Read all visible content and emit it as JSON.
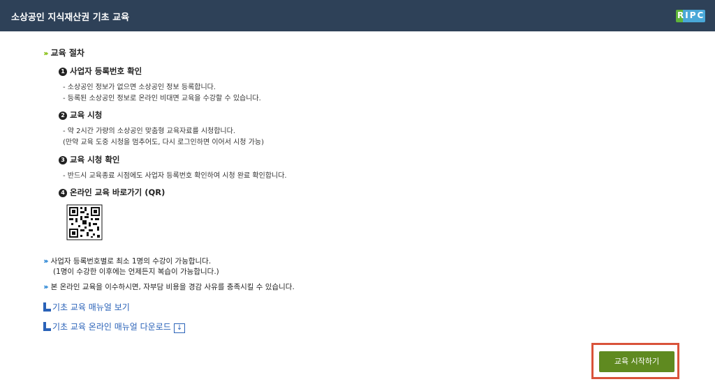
{
  "header": {
    "title": "소상공인 지식재산권 기초 교육",
    "logo_text": "RIPC"
  },
  "procedure": {
    "title": "교육 절차",
    "steps": [
      {
        "num": "1",
        "title": "사업자 등록번호 확인",
        "lines": [
          "- 소상공인 정보가 없으면 소상공인 정보 등록합니다.",
          "- 등록된 소상공인 정보로 온라인 비대면 교육을 수강할 수 있습니다."
        ]
      },
      {
        "num": "2",
        "title": "교육 시청",
        "lines": [
          "- 약 2시간 가량의 소상공인 맞춤형 교육자료를 시청합니다.",
          "(만약 교육 도중 시청을 멈추어도, 다시 로그인하면 이어서 시청 가능)"
        ]
      },
      {
        "num": "3",
        "title": "교육 시청 확인",
        "lines": [
          "- 반드시 교육종료 시점에도 사업자 등록번호 확인하여 시청 완료 확인합니다."
        ]
      },
      {
        "num": "4",
        "title": "온라인 교육 바로가기 (QR)",
        "lines": []
      }
    ]
  },
  "notes": {
    "note1": "사업자 등록번호별로 최소 1명의 수강이 가능합니다.",
    "note1_sub": "(1명이 수강한 이후에는 언제든지 복습이 가능합니다.)",
    "note2": "본 온라인 교육을 이수하시면, 자부담 비용을 경감 사유를 충족시킬 수 있습니다."
  },
  "links": {
    "manual_view": "기초 교육 매뉴얼 보기",
    "manual_download": "기초 교육 온라인 매뉴얼 다운로드"
  },
  "actions": {
    "start_label": "교육 시작하기"
  },
  "colors": {
    "header_bg": "#2e4158",
    "button": "#5f8a20",
    "highlight": "#d9533a",
    "link": "#2a62b8"
  }
}
